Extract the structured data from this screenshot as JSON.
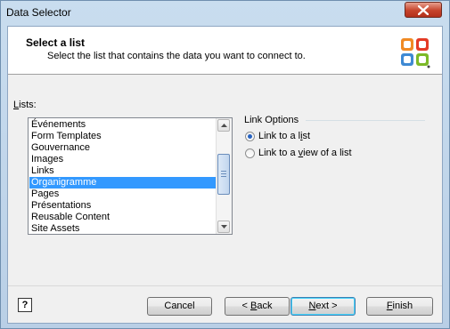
{
  "window": {
    "title": "Data Selector"
  },
  "header": {
    "title": "Select a list",
    "subtitle": "Select the list that contains the data you want to connect to.",
    "logo_icon": "office-logo-icon"
  },
  "lists": {
    "label_underlined": "L",
    "label_rest": "ists:",
    "items": [
      "Événements",
      "Form Templates",
      "Gouvernance",
      "Images",
      "Links",
      "Organigramme",
      "Pages",
      "Présentations",
      "Reusable Content",
      "Site Assets"
    ],
    "selected_index": 5,
    "selected_color": "#3399ff"
  },
  "link_options": {
    "label": "Link Options",
    "option1_pre": "Link to a l",
    "option1_u": "i",
    "option1_post": "st",
    "option2_pre": "Link to a ",
    "option2_u": "v",
    "option2_post": "iew of a list",
    "selected": "option1"
  },
  "buttons": {
    "help": "?",
    "cancel": "Cancel",
    "back_pre": "< ",
    "back_u": "B",
    "back_post": "ack",
    "next_u": "N",
    "next_post": "ext >",
    "finish_u": "F",
    "finish_post": "inish"
  }
}
